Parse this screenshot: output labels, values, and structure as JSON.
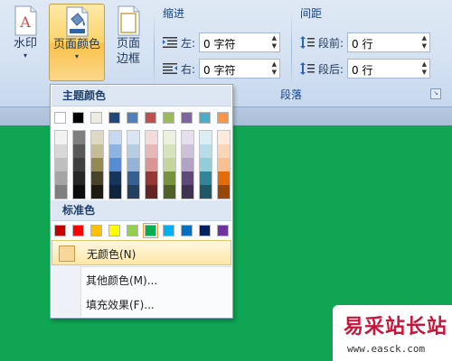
{
  "ribbon": {
    "watermark_btn": {
      "label": "水印",
      "arrow": "▾",
      "icon": "watermark-icon"
    },
    "page_color_btn": {
      "label": "页面颜色",
      "arrow": "▾",
      "icon": "page-color-icon"
    },
    "page_border_btn": {
      "label_line1": "页面",
      "label_line2": "边框",
      "icon": "page-border-icon"
    },
    "indent": {
      "title": "缩进",
      "left_label": "左:",
      "left_value": "0 字符",
      "right_label": "右:",
      "right_value": "0 字符"
    },
    "spacing": {
      "title": "间距",
      "before_label": "段前:",
      "before_value": "0 行",
      "after_label": "段后:",
      "after_value": "0 行"
    },
    "paragraph_group_label": "段落",
    "spin_arrows": "▲\n▼"
  },
  "color_panel": {
    "theme_header": "主题颜色",
    "standard_header": "标准色",
    "theme_colors": [
      "#ffffff",
      "#000000",
      "#eeece1",
      "#1f497d",
      "#4f81bd",
      "#c0504d",
      "#9bbb59",
      "#8064a2",
      "#4bacc6",
      "#f79646"
    ],
    "theme_tints": [
      [
        "#f2f2f2",
        "#d8d8d8",
        "#bfbfbf",
        "#a5a5a5",
        "#7f7f7f"
      ],
      [
        "#7f7f7f",
        "#595959",
        "#3f3f3f",
        "#262626",
        "#0c0c0c"
      ],
      [
        "#ddd9c3",
        "#c4bd97",
        "#938953",
        "#494429",
        "#1d1b10"
      ],
      [
        "#c6d9f0",
        "#8db3e2",
        "#548dd4",
        "#17365d",
        "#0f243e"
      ],
      [
        "#dbe5f1",
        "#b8cce4",
        "#95b3d7",
        "#366092",
        "#244061"
      ],
      [
        "#f2dcdb",
        "#e5b9b7",
        "#d99694",
        "#953734",
        "#632423"
      ],
      [
        "#ebf1dd",
        "#d7e3bc",
        "#c3d69b",
        "#76923c",
        "#4f6128"
      ],
      [
        "#e5e0ec",
        "#ccc1d9",
        "#b2a2c7",
        "#5f497a",
        "#3f3151"
      ],
      [
        "#dbeef3",
        "#b7dde8",
        "#92cddc",
        "#31859b",
        "#205867"
      ],
      [
        "#fdeada",
        "#fbd5b5",
        "#fac08f",
        "#e36c09",
        "#974806"
      ]
    ],
    "standard_colors": [
      "#c00000",
      "#ff0000",
      "#ffc000",
      "#ffff00",
      "#92d050",
      "#00b050",
      "#00b0f0",
      "#0070c0",
      "#002060",
      "#7030a0"
    ],
    "menu": {
      "no_color": "无颜色(N)",
      "more_colors": "其他颜色(M)...",
      "fill_effects": "填充效果(F)..."
    }
  },
  "watermark": {
    "site_name": "易采站长站",
    "url": "www.easck.com"
  }
}
